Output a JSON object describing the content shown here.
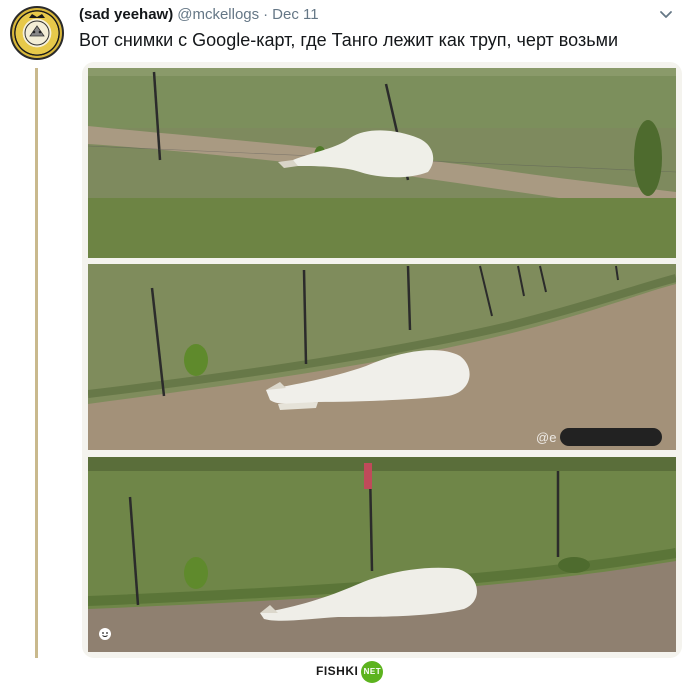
{
  "tweet": {
    "display_name": "(sad yeehaw)",
    "handle": "@mckellogs",
    "separator": "·",
    "date": "Dec 11",
    "text": "Вот снимки с Google-карт, где Танго лежит как труп, черт возьми",
    "avatar_icon": "trash-queen-badge-icon",
    "menu_icon": "chevron-down-icon"
  },
  "media": {
    "watermark_prefix": "@e",
    "photo_count": 3
  },
  "footer": {
    "logo_text": "FISHKI",
    "badge_text": "NET"
  },
  "colors": {
    "handle_gray": "#657786",
    "grass": "#6f8a4a",
    "dirt": "#9a8a72",
    "badge_green": "#5cb31e"
  }
}
